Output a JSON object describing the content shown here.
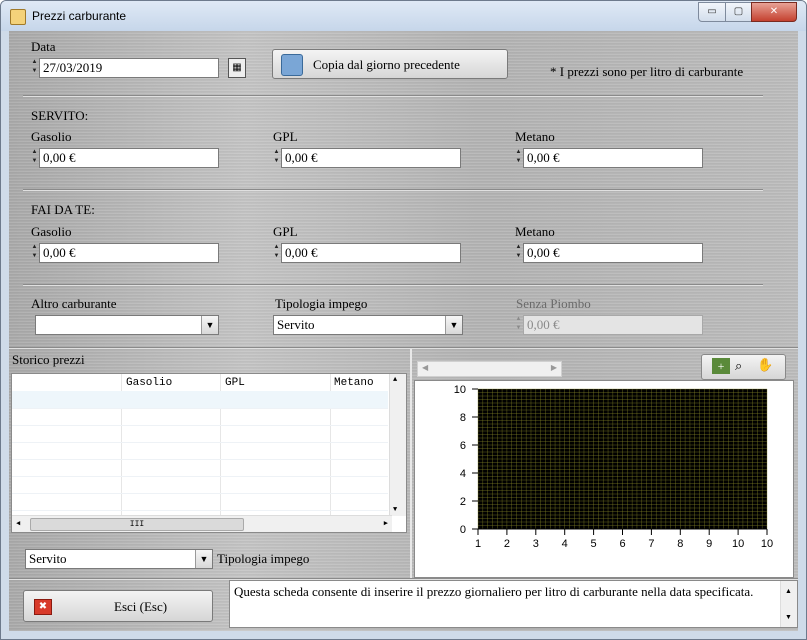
{
  "window": {
    "title": "Prezzi carburante",
    "min": "▭",
    "max": "▢",
    "close": "✕"
  },
  "top": {
    "data_label": "Data",
    "data_value": "27/03/2019",
    "copy_button": "Copia dal giorno precedente",
    "note": "* I prezzi sono per litro di carburante"
  },
  "servito": {
    "title": "SERVITO:",
    "gasolio_label": "Gasolio",
    "gasolio_value": "0,00 €",
    "gpl_label": "GPL",
    "gpl_value": "0,00 €",
    "metano_label": "Metano",
    "metano_value": "0,00 €"
  },
  "faidate": {
    "title": "FAI DA TE:",
    "gasolio_label": "Gasolio",
    "gasolio_value": "0,00 €",
    "gpl_label": "GPL",
    "gpl_value": "0,00 €",
    "metano_label": "Metano",
    "metano_value": "0,00 €"
  },
  "extra": {
    "altro_label": "Altro carburante",
    "altro_value": "",
    "tipologia_label": "Tipologia impego",
    "tipologia_value": "Servito",
    "senza_label": "Senza Piombo",
    "senza_value": "0,00 €"
  },
  "storico": {
    "title": "Storico prezzi",
    "columns": [
      "",
      "Gasolio",
      "GPL",
      "Metano"
    ],
    "filter_value": "Servito",
    "filter_label": "Tipologia impego",
    "hscroll_thumb": "III"
  },
  "chart_data": {
    "type": "line",
    "x_ticks": [
      "1",
      "2",
      "3",
      "4",
      "5",
      "6",
      "7",
      "8",
      "9",
      "10",
      "10"
    ],
    "y_ticks": [
      "0",
      "2",
      "4",
      "6",
      "8",
      "10"
    ],
    "ylim": [
      0,
      10
    ],
    "grid": true,
    "series": [],
    "colors": {
      "plot_bg": "#000000",
      "grid": "#8a8a2a"
    }
  },
  "footer": {
    "exit_button": "Esci (Esc)",
    "description": "Questa scheda consente di inserire il prezzo giornaliero per litro di carburante nella data specificata."
  }
}
